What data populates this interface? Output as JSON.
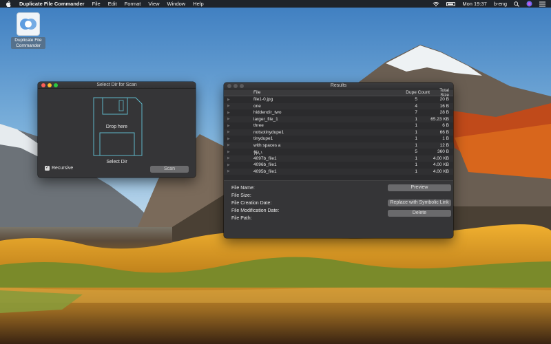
{
  "menubar": {
    "app_name": "Duplicate File Commander",
    "menus": [
      "File",
      "Edit",
      "Format",
      "View",
      "Window",
      "Help"
    ],
    "clock": "Mon 19:37",
    "user": "b-eng",
    "icons": [
      "wifi-icon",
      "battery-icon",
      "spotlight-icon",
      "siri-icon",
      "notification-center-icon"
    ]
  },
  "desktop_icon": {
    "label": "Duplicate File Commander"
  },
  "select_window": {
    "title": "Select Dir for Scan",
    "drop_text": "Drop here",
    "select_label": "Select Dir",
    "recursive_label": "Recursive",
    "recursive_checked": true,
    "scan_label": "Scan"
  },
  "results_window": {
    "title": "Results",
    "columns": {
      "file": "File",
      "dupe": "Dupe Count",
      "size": "Total Size"
    },
    "rows": [
      {
        "file": "file1-0.jpg",
        "dupe": "5",
        "size": "20 B"
      },
      {
        "file": "one",
        "dupe": "4",
        "size": "16 B"
      },
      {
        "file": "hiddendir_two",
        "dupe": "7",
        "size": "28 B"
      },
      {
        "file": "larger_file_1",
        "dupe": "1",
        "size": "65.23 KB"
      },
      {
        "file": "three",
        "dupe": "1",
        "size": "6 B"
      },
      {
        "file": "notsotinydupe1",
        "dupe": "1",
        "size": "66 B"
      },
      {
        "file": "tinydupe1",
        "dupe": "1",
        "size": "1 B"
      },
      {
        "file": "with spaces a",
        "dupe": "1",
        "size": "12 B"
      },
      {
        "file": "怖い",
        "dupe": "5",
        "size": "360 B"
      },
      {
        "file": "4097b_file1",
        "dupe": "1",
        "size": "4.00 KB"
      },
      {
        "file": "4096b_file1",
        "dupe": "1",
        "size": "4.00 KB"
      },
      {
        "file": "4095b_file1",
        "dupe": "1",
        "size": "4.00 KB"
      }
    ],
    "details": {
      "file_name": "File Name:",
      "file_size": "File Size:",
      "creation": "File Creation Date:",
      "modification": "File Modification Date:",
      "path": "File Path:"
    },
    "buttons": {
      "preview": "Preview",
      "replace": "Replace with Symbolic Link",
      "delete": "Delete"
    }
  }
}
